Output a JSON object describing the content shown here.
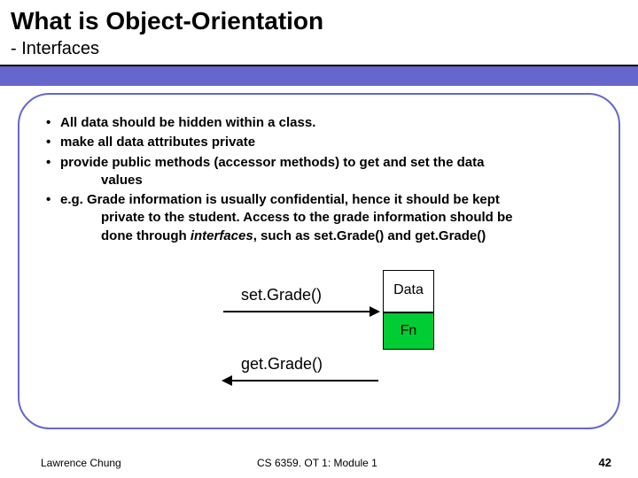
{
  "title": "What is Object-Orientation",
  "subtitle": "- Interfaces",
  "bullets": {
    "b1": "All data should be hidden within a class.",
    "b2": "make all data attributes private",
    "b3a": "provide public methods (accessor methods) to get and set the data",
    "b3b": "values",
    "b4a": "e.g. Grade information is usually confidential, hence it should be kept",
    "b4b": "private to the student.  Access to the grade information should be",
    "b4c_pre": "done through ",
    "b4c_em": "interfaces",
    "b4c_post": ", such as set.Grade() and get.Grade()"
  },
  "diagram": {
    "set": "set.Grade()",
    "get": "get.Grade()",
    "data": "Data",
    "fn": "Fn"
  },
  "footer": {
    "author": "Lawrence Chung",
    "course": "CS 6359. OT 1: Module 1",
    "page": "42"
  }
}
